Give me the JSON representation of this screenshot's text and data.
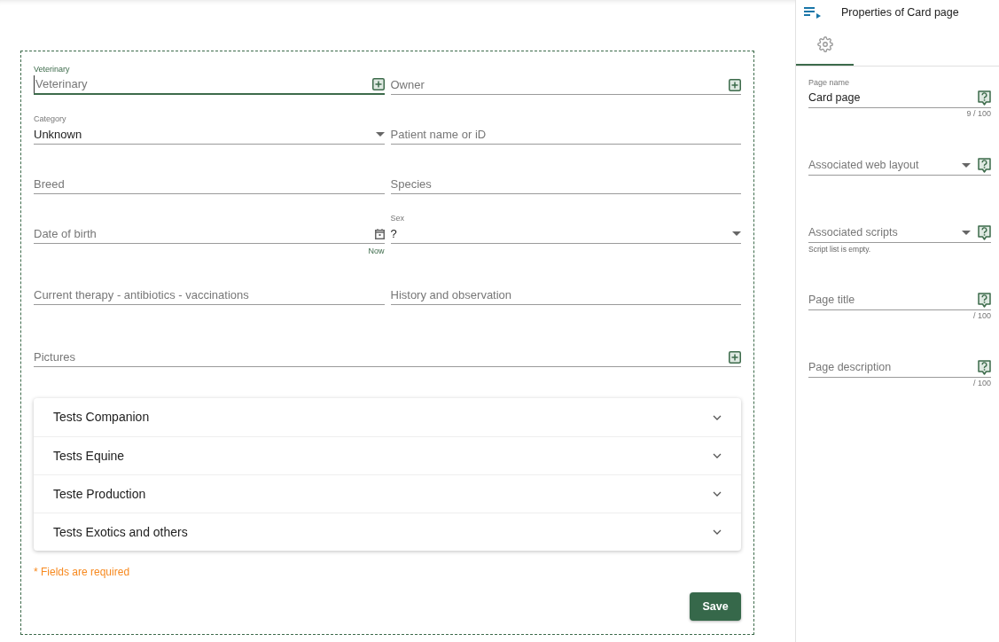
{
  "form": {
    "rows": [
      {
        "fields": [
          {
            "kind": "text",
            "label": "Veterinary",
            "placeholder": "Veterinary",
            "focused": true,
            "addable": true
          },
          {
            "kind": "text",
            "placeholder": "Owner",
            "focused": false,
            "addable": true
          }
        ]
      },
      {
        "fields": [
          {
            "kind": "select",
            "label": "Category",
            "value": "Unknown",
            "focused": false,
            "addable": false
          },
          {
            "kind": "text",
            "placeholder": "Patient name or iD",
            "focused": false,
            "addable": false
          }
        ]
      },
      {
        "fields": [
          {
            "kind": "text",
            "placeholder": "Breed",
            "focused": false,
            "addable": false
          },
          {
            "kind": "text",
            "placeholder": "Species",
            "focused": false,
            "addable": false
          }
        ]
      },
      {
        "fields": [
          {
            "kind": "date",
            "placeholder": "Date of birth",
            "action": "Now",
            "focused": false,
            "addable": false
          },
          {
            "kind": "select",
            "label": "Sex",
            "value": "?",
            "focused": false,
            "addable": false
          }
        ]
      },
      {
        "fields": [
          {
            "kind": "text",
            "placeholder": "Current therapy - antibiotics - vaccinations",
            "focused": false,
            "addable": false
          },
          {
            "kind": "text",
            "placeholder": "History and observation",
            "focused": false,
            "addable": false
          }
        ]
      },
      {
        "fields": [
          {
            "kind": "text",
            "placeholder": "Pictures",
            "focused": false,
            "addable": true
          }
        ]
      }
    ],
    "sections": [
      {
        "title": "Tests Companion",
        "expanded": false
      },
      {
        "title": "Tests Equine",
        "expanded": false
      },
      {
        "title": "Teste Production",
        "expanded": false
      },
      {
        "title": "Tests Exotics and others",
        "expanded": false
      }
    ],
    "required_note": "* Fields are required",
    "save_button": "Save"
  },
  "panel": {
    "title": "Properties of Card page",
    "tabs": [
      {
        "selected": true
      }
    ],
    "fields": [
      {
        "kind": "text",
        "label": "Page name",
        "value": "Card page",
        "counter": "9 / 100"
      },
      {
        "kind": "select",
        "placeholder": "Associated web layout"
      },
      {
        "kind": "select",
        "placeholder": "Associated scripts",
        "hint": "Script list is empty."
      },
      {
        "kind": "text",
        "placeholder": "Page title",
        "counter": "/ 100"
      },
      {
        "kind": "text",
        "placeholder": "Page description",
        "counter": "/ 100"
      }
    ]
  }
}
